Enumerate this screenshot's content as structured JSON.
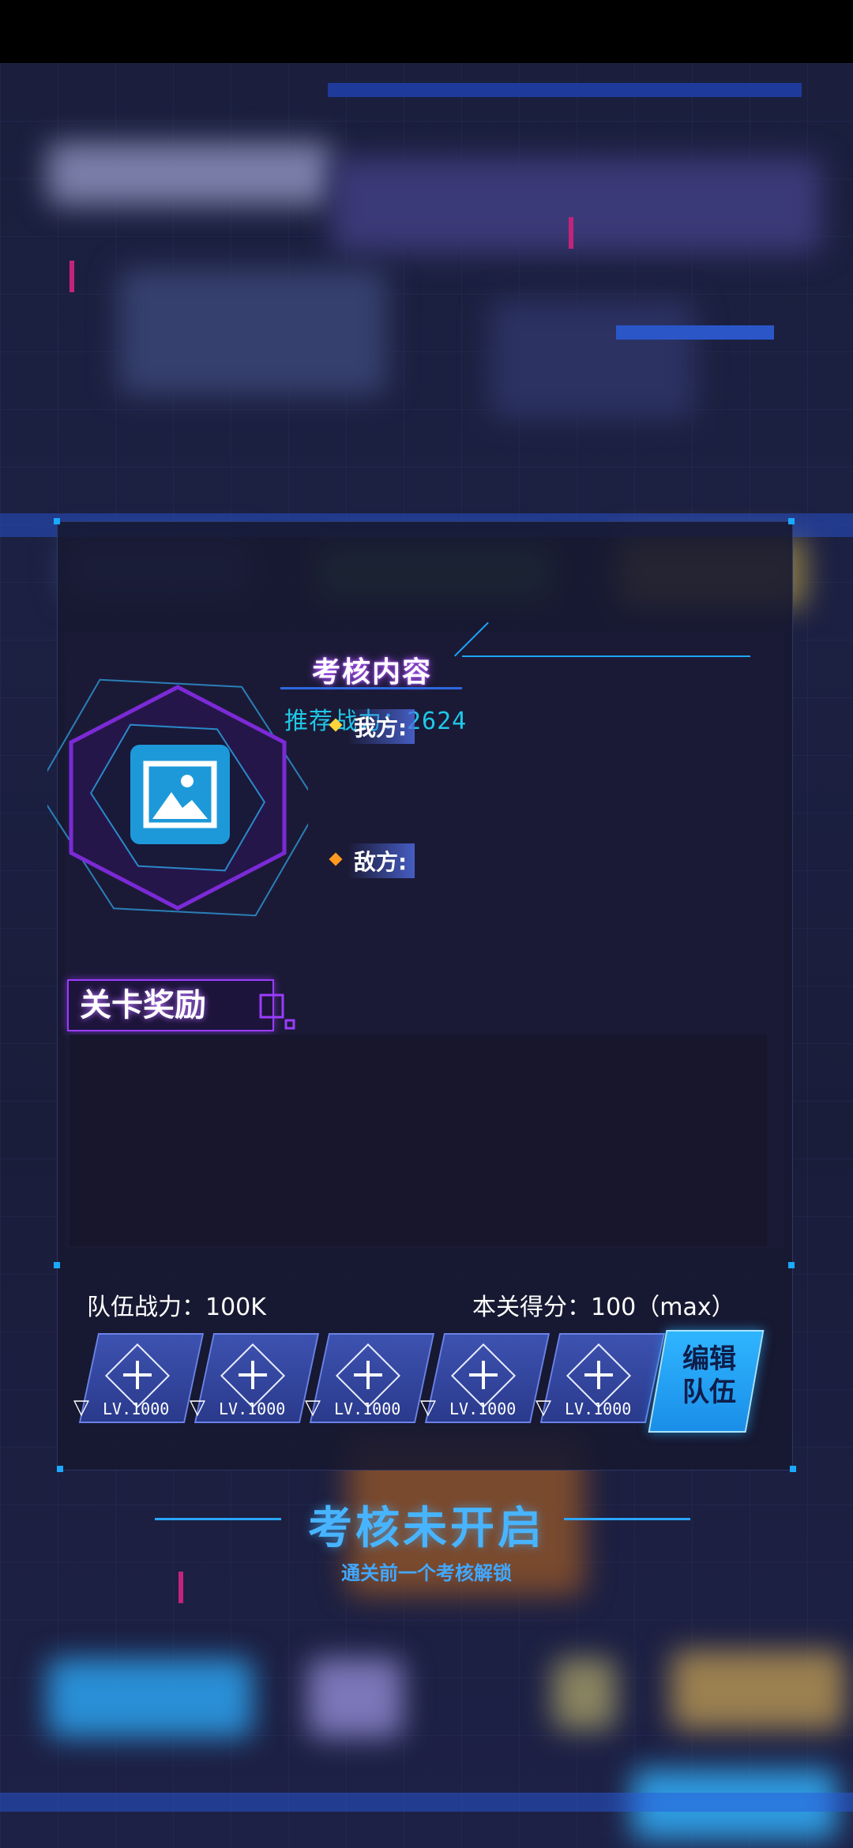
{
  "assessment": {
    "title": "考核内容",
    "recommended_power": "推荐战力：2624",
    "our_side_label": "我方:",
    "enemy_side_label": "敌方:"
  },
  "rewards": {
    "title": "关卡奖励"
  },
  "team": {
    "power_label": "队伍战力：100K",
    "score_label": "本关得分：100（max）",
    "slots": [
      {
        "level": "LV.1000"
      },
      {
        "level": "LV.1000"
      },
      {
        "level": "LV.1000"
      },
      {
        "level": "LV.1000"
      },
      {
        "level": "LV.1000"
      }
    ],
    "edit_button_line1": "编辑",
    "edit_button_line2": "队伍"
  },
  "status": {
    "title": "考核未开启",
    "hint": "通关前一个考核解锁"
  },
  "colors": {
    "accent_cyan": "#1fc8e8",
    "accent_purple": "#9b3cff",
    "accent_blue": "#2ba6ff",
    "slot_blue": "#3d52b0"
  },
  "icons": {
    "stage_image": "image-placeholder-icon",
    "slot_add": "plus-icon",
    "slot_rank": "rank-triangle-icon"
  }
}
